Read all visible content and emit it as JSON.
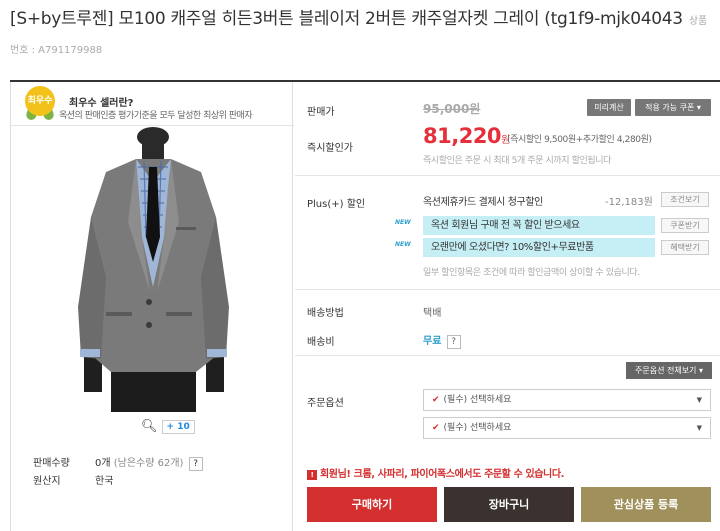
{
  "product": {
    "title": "[S+by트루젠] 모100 캐주얼 히든3버튼 블레이저 2버튼 캐주얼자켓 그레이 (tg1f9-mjk04043",
    "code_label": "상품번호 : A791179988"
  },
  "seller": {
    "badge": "최우수",
    "title": "최우수 셀러란?",
    "desc": "옥션의 판매인증 평가기준을 모두 달성한 최상위 판매자"
  },
  "gallery": {
    "zoom_icon": "magnifier-icon",
    "more_count": "+ 10"
  },
  "left_info": {
    "sold_label": "판매수량",
    "sold_value": "0개",
    "sold_sub": "(남은수량 62개)",
    "help": "?",
    "origin_label": "원산지",
    "origin_value": "한국"
  },
  "price": {
    "label": "판매가",
    "original": "95,000원",
    "calc_btn": "미리계산",
    "coupon_btn": "적용 가능 쿠폰 ▾",
    "sale_label": "즉시할인가",
    "sale_value": "81,220",
    "sale_unit": "원",
    "sale_detail": "(즉시할인 9,500원+추가할인 4,280원)",
    "sale_note": "즉시할인은 주문 시 최대 5개 주문 시까지 할인됩니다"
  },
  "plus": {
    "label": "Plus(+) 할인",
    "card": "옥션제휴카드 결제시 청구할인",
    "amount": "-12,183원",
    "condition_btn": "조건보기",
    "banners": [
      {
        "tag": "NEW",
        "text": "옥션 회원님 구매 전 꼭 할인 받으세요",
        "btn": "쿠폰받기"
      },
      {
        "tag": "NEW",
        "text": "오랜만에 오셨다면? 10%할인+무료반품",
        "btn": "혜택받기"
      }
    ],
    "note": "일부 할인항목은 조건에 따라 할인금액이 상이할 수 있습니다."
  },
  "shipping": {
    "method_label": "배송방법",
    "method_value": "택배",
    "fee_label": "배송비",
    "fee_value": "무료",
    "help": "?"
  },
  "options": {
    "view_all_btn": "주문옵션 전체보기 ▾",
    "label": "주문옵션",
    "selects": [
      "(필수) 선택하세요",
      "(필수) 선택하세요"
    ]
  },
  "warning": "회원님! 크롬, 사파리, 파이어폭스에서도 주문할 수 있습니다.",
  "actions": {
    "buy": "구매하기",
    "cart": "장바구니",
    "wish": "관심상품 등록"
  },
  "colors": {
    "sale_red": "#e5303b",
    "buy_btn": "#d32f2f",
    "cart_btn": "#3b3230",
    "wish_btn": "#a0905c",
    "banner_cyan": "#c5eef5"
  }
}
